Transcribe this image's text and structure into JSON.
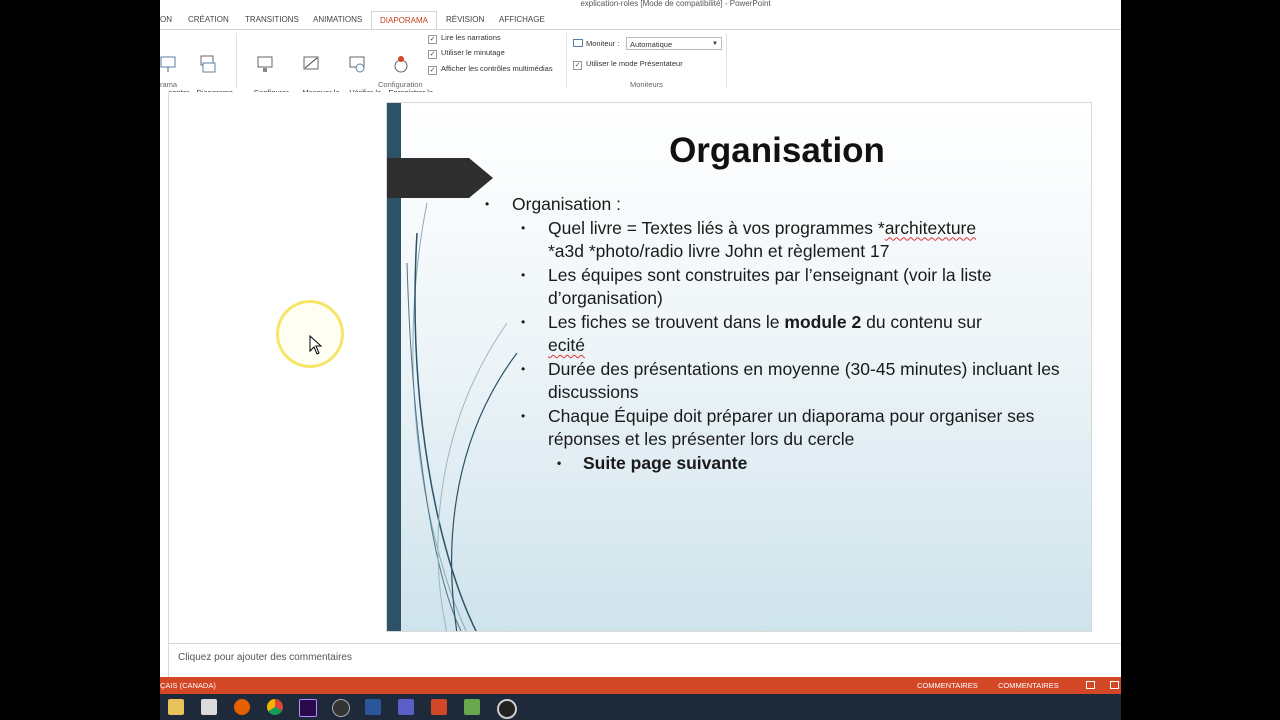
{
  "window": {
    "title": "explication-roles [Mode de compatibilité] - PowerPoint"
  },
  "ribbon": {
    "tabs": [
      {
        "label": "ON"
      },
      {
        "label": "CRÉATION"
      },
      {
        "label": "TRANSITIONS"
      },
      {
        "label": "ANIMATIONS"
      },
      {
        "label": "DIAPORAMA",
        "active": true
      },
      {
        "label": "RÉVISION"
      },
      {
        "label": "AFFICHAGE"
      }
    ],
    "buttons": {
      "presenter": "senter\ngne",
      "custom_show": "Diaporama\npersonnalisé",
      "setup": "Configurer\nle diaporama",
      "hide": "Masquer la\ndiapositive",
      "rehearse": "Vérifier le\nminutage",
      "record": "Enregistrer le\ndiaporama"
    },
    "checkboxes": {
      "narrations": "Lire les narrations",
      "timings": "Utiliser le minutage",
      "media_controls": "Afficher les contrôles multimédias",
      "presenter_view": "Utiliser le mode Présentateur"
    },
    "monitor_label": "Moniteur :",
    "monitor_value": "Automatique",
    "groups": {
      "start": "rama",
      "setup": "Configuration",
      "monitors": "Moniteurs"
    }
  },
  "slide": {
    "title": "Organisation",
    "bullets": {
      "l1": "Organisation :",
      "item1_pre": "Quel livre = Textes liés à vos programmes *",
      "item1_squig": "architexture",
      "item1_post": "*a3d *photo/radio livre John et règlement 17",
      "item2": "Les équipes sont construites par l’enseignant (voir la liste d’organisation)",
      "item3_pre": "Les fiches se trouvent dans le ",
      "item3_bold": "module 2",
      "item3_mid": " du contenu sur ",
      "item3_squig": "ecité",
      "item4": "Durée des présentations en moyenne (30-45 minutes) incluant les discussions",
      "item5": "Chaque Équipe doit préparer un diaporama pour organiser ses réponses et les présenter lors du cercle",
      "sub1": "Suite page suivante"
    },
    "bullet_char": "•"
  },
  "notes_placeholder": "Cliquez pour ajouter des commentaires",
  "statusbar": {
    "language": "ÇAIS (CANADA)",
    "notes": "COMMENTAIRES",
    "comments": "COMMENTAIRES"
  },
  "colors": {
    "accent": "#c43e1c",
    "statusbar": "#d24726",
    "slide_bar": "#2c5266"
  },
  "taskbar_icons": [
    "file-explorer-icon",
    "store-icon",
    "firefox-icon",
    "chrome-icon",
    "premiere-icon",
    "app-icon",
    "word-icon",
    "teams-icon",
    "powerpoint-icon",
    "image-viewer-icon",
    "obs-icon"
  ]
}
